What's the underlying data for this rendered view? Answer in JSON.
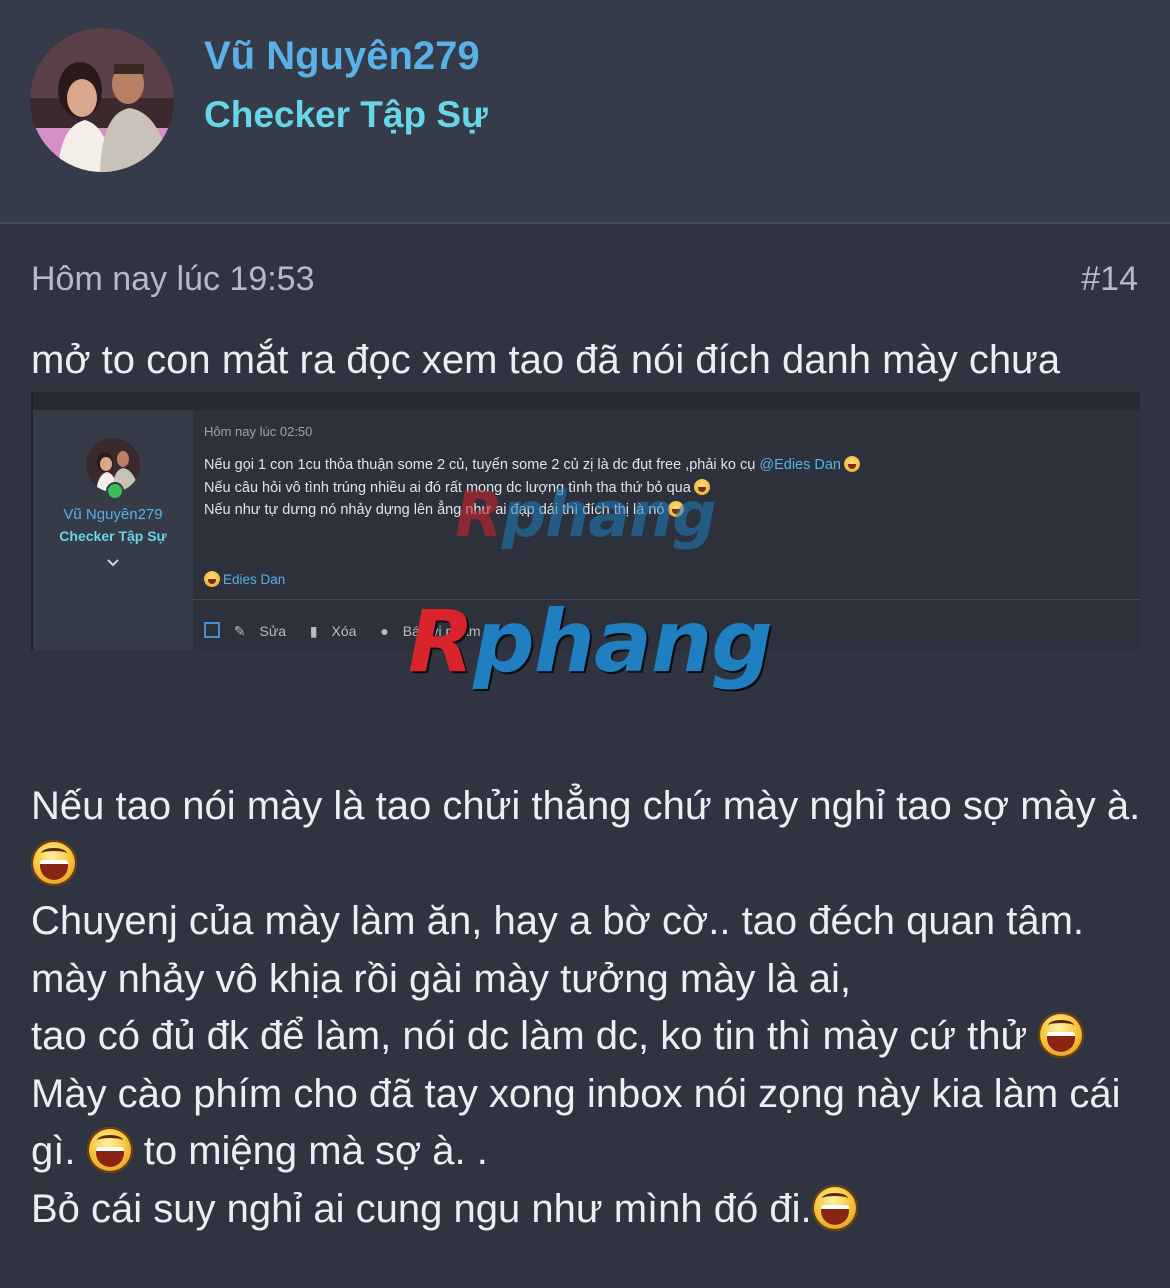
{
  "user": {
    "name": "Vũ Nguyên279",
    "title": "Checker Tập Sự"
  },
  "post": {
    "timestamp": "Hôm nay lúc 19:53",
    "number": "#14",
    "intro": "mở to con mắt ra đọc xem tao đã nói đích danh mày chưa",
    "body": [
      "Nếu tao nói mày là tao chửi thẳng chứ mày nghỉ tao sợ mày à.",
      "Chuyenj của mày làm ăn, hay a bờ cờ.. tao đéch quan tâm.",
      "mày nhảy vô khịa rồi gài mày tưởng mày là ai,",
      "tao có đủ đk để làm, nói dc làm dc, ko tin thì mày cứ thử",
      "Mày cào phím cho đã tay xong inbox nói zọng này kia làm cái gì.",
      "to miệng mà sợ à. .",
      "Bỏ cái suy nghỉ ai cung ngu như mình đó đi."
    ]
  },
  "embedded": {
    "user_name": "Vũ Nguyên279",
    "user_title": "Checker Tập Sự",
    "timestamp": "Hôm nay lúc 02:50",
    "line1": "Nếu gọi 1 con 1cu thỏa thuận some 2 củ, tuyển some 2 củ zị là dc đụt free ,phải ko cụ",
    "mention": "@Edies Dan",
    "line2": "Nếu câu hỏi vô tình trúng nhiều ai đó rất mong dc lượng tình tha thứ bỏ qua",
    "line3": "Nếu như tự dưng nó nhảy dựng lên ẳng như ai đạp dái thì đích thị là nó",
    "reaction_user": "Edies Dan",
    "actions": {
      "edit": "Sửa",
      "delete": "Xóa",
      "report": "Báo vi phạm"
    }
  },
  "watermark": {
    "first": "R",
    "rest": "phang"
  },
  "icons": {
    "emoji": "laughing-face-icon",
    "edit": "pencil-icon",
    "delete": "trash-icon",
    "report": "info-icon",
    "chevron": "chevron-down-icon",
    "online": "online-status-icon"
  },
  "colors": {
    "background": "#2f3440",
    "header": "#353b48",
    "username": "#5ab0e8",
    "usertitle": "#67d6e8"
  }
}
